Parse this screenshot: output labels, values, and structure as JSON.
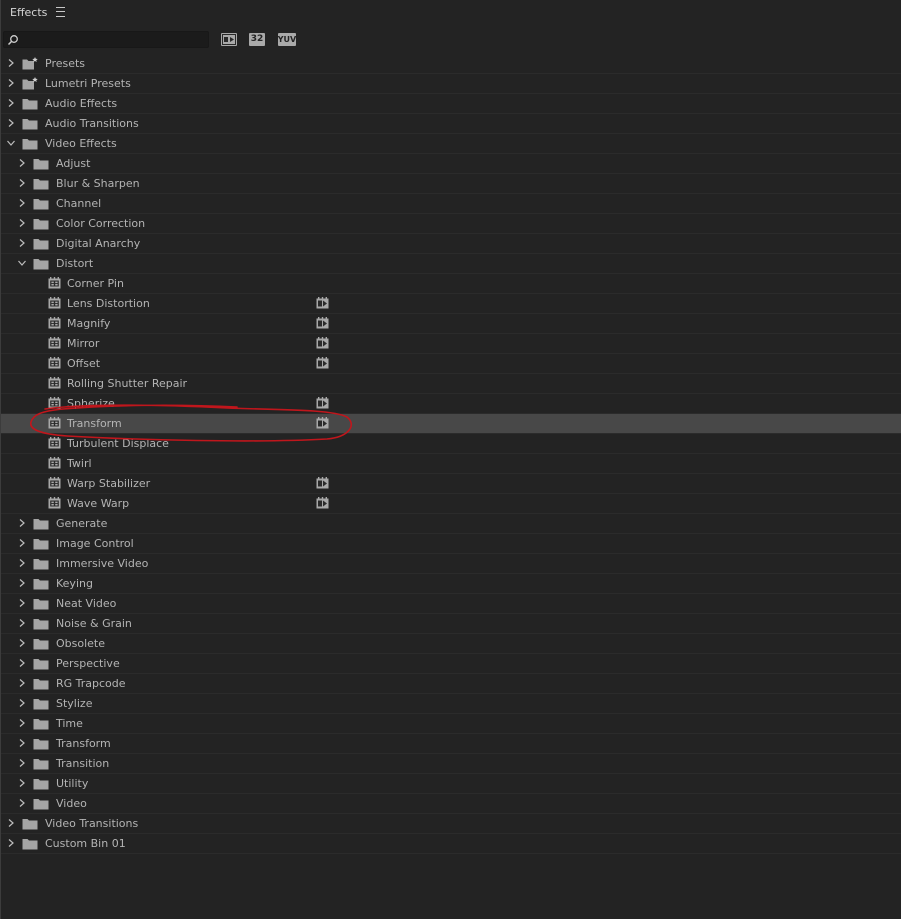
{
  "panel": {
    "title": "Effects",
    "search_placeholder": "",
    "toolbar": {
      "accelerated_label": "",
      "bit32_label": "32",
      "yuv_label": "YUV"
    }
  },
  "colors": {
    "background": "#232323",
    "selected_row": "#484848",
    "annotation": "#c0161c",
    "folder": "#a5a5a5"
  },
  "tree": [
    {
      "label": "Presets",
      "level": 0,
      "type": "preset-folder",
      "expanded": false
    },
    {
      "label": "Lumetri Presets",
      "level": 0,
      "type": "preset-folder",
      "expanded": false
    },
    {
      "label": "Audio Effects",
      "level": 0,
      "type": "folder",
      "expanded": false
    },
    {
      "label": "Audio Transitions",
      "level": 0,
      "type": "folder",
      "expanded": false
    },
    {
      "label": "Video Effects",
      "level": 0,
      "type": "folder",
      "expanded": true
    },
    {
      "label": "Adjust",
      "level": 1,
      "type": "folder",
      "expanded": false
    },
    {
      "label": "Blur & Sharpen",
      "level": 1,
      "type": "folder",
      "expanded": false
    },
    {
      "label": "Channel",
      "level": 1,
      "type": "folder",
      "expanded": false
    },
    {
      "label": "Color Correction",
      "level": 1,
      "type": "folder",
      "expanded": false
    },
    {
      "label": "Digital Anarchy",
      "level": 1,
      "type": "folder",
      "expanded": false
    },
    {
      "label": "Distort",
      "level": 1,
      "type": "folder",
      "expanded": true
    },
    {
      "label": "Corner Pin",
      "level": 2,
      "type": "effect",
      "accelerated": false
    },
    {
      "label": "Lens Distortion",
      "level": 2,
      "type": "effect",
      "accelerated": true
    },
    {
      "label": "Magnify",
      "level": 2,
      "type": "effect",
      "accelerated": true
    },
    {
      "label": "Mirror",
      "level": 2,
      "type": "effect",
      "accelerated": true
    },
    {
      "label": "Offset",
      "level": 2,
      "type": "effect",
      "accelerated": true
    },
    {
      "label": "Rolling Shutter Repair",
      "level": 2,
      "type": "effect",
      "accelerated": false
    },
    {
      "label": "Spherize",
      "level": 2,
      "type": "effect",
      "accelerated": true
    },
    {
      "label": "Transform",
      "level": 2,
      "type": "effect",
      "accelerated": true,
      "selected": true
    },
    {
      "label": "Turbulent Displace",
      "level": 2,
      "type": "effect",
      "accelerated": false
    },
    {
      "label": "Twirl",
      "level": 2,
      "type": "effect",
      "accelerated": false
    },
    {
      "label": "Warp Stabilizer",
      "level": 2,
      "type": "effect",
      "accelerated": true
    },
    {
      "label": "Wave Warp",
      "level": 2,
      "type": "effect",
      "accelerated": true
    },
    {
      "label": "Generate",
      "level": 1,
      "type": "folder",
      "expanded": false
    },
    {
      "label": "Image Control",
      "level": 1,
      "type": "folder",
      "expanded": false
    },
    {
      "label": "Immersive Video",
      "level": 1,
      "type": "folder",
      "expanded": false
    },
    {
      "label": "Keying",
      "level": 1,
      "type": "folder",
      "expanded": false
    },
    {
      "label": "Neat Video",
      "level": 1,
      "type": "folder",
      "expanded": false
    },
    {
      "label": "Noise & Grain",
      "level": 1,
      "type": "folder",
      "expanded": false
    },
    {
      "label": "Obsolete",
      "level": 1,
      "type": "folder",
      "expanded": false
    },
    {
      "label": "Perspective",
      "level": 1,
      "type": "folder",
      "expanded": false
    },
    {
      "label": "RG Trapcode",
      "level": 1,
      "type": "folder",
      "expanded": false
    },
    {
      "label": "Stylize",
      "level": 1,
      "type": "folder",
      "expanded": false
    },
    {
      "label": "Time",
      "level": 1,
      "type": "folder",
      "expanded": false
    },
    {
      "label": "Transform",
      "level": 1,
      "type": "folder",
      "expanded": false
    },
    {
      "label": "Transition",
      "level": 1,
      "type": "folder",
      "expanded": false
    },
    {
      "label": "Utility",
      "level": 1,
      "type": "folder",
      "expanded": false
    },
    {
      "label": "Video",
      "level": 1,
      "type": "folder",
      "expanded": false
    },
    {
      "label": "Video Transitions",
      "level": 0,
      "type": "folder",
      "expanded": false
    },
    {
      "label": "Custom Bin 01",
      "level": 0,
      "type": "folder",
      "expanded": false
    }
  ]
}
